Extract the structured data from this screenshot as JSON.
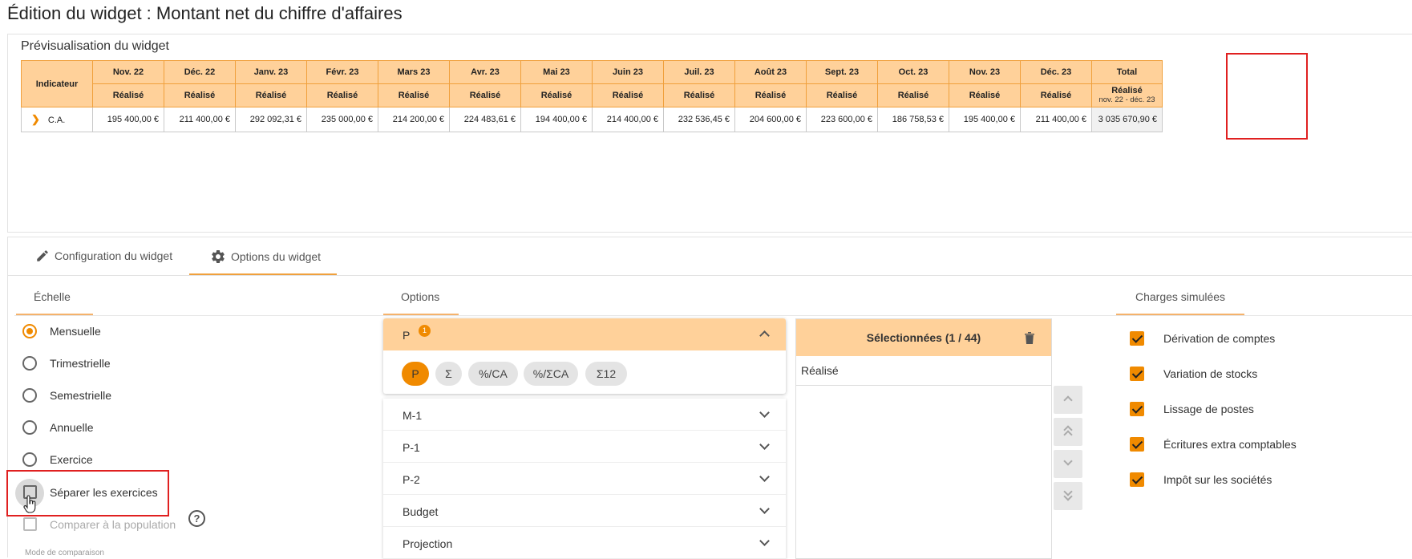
{
  "page": {
    "title": "Édition du widget : Montant net du chiffre d'affaires"
  },
  "preview": {
    "title": "Prévisualisation du widget",
    "indicator_header": "Indicateur",
    "months": [
      {
        "label": "Nov. 22",
        "sub": "Réalisé",
        "value": "195 400,00 €"
      },
      {
        "label": "Déc. 22",
        "sub": "Réalisé",
        "value": "211 400,00 €"
      },
      {
        "label": "Janv. 23",
        "sub": "Réalisé",
        "value": "292 092,31 €"
      },
      {
        "label": "Févr. 23",
        "sub": "Réalisé",
        "value": "235 000,00 €"
      },
      {
        "label": "Mars 23",
        "sub": "Réalisé",
        "value": "214 200,00 €"
      },
      {
        "label": "Avr. 23",
        "sub": "Réalisé",
        "value": "224 483,61 €"
      },
      {
        "label": "Mai 23",
        "sub": "Réalisé",
        "value": "194 400,00 €"
      },
      {
        "label": "Juin 23",
        "sub": "Réalisé",
        "value": "214 400,00 €"
      },
      {
        "label": "Juil. 23",
        "sub": "Réalisé",
        "value": "232 536,45 €"
      },
      {
        "label": "Août 23",
        "sub": "Réalisé",
        "value": "204 600,00 €"
      },
      {
        "label": "Sept. 23",
        "sub": "Réalisé",
        "value": "223 600,00 €"
      },
      {
        "label": "Oct. 23",
        "sub": "Réalisé",
        "value": "186 758,53 €"
      },
      {
        "label": "Nov. 23",
        "sub": "Réalisé",
        "value": "195 400,00 €"
      },
      {
        "label": "Déc. 23",
        "sub": "Réalisé",
        "value": "211 400,00 €"
      }
    ],
    "total": {
      "label": "Total",
      "sub": "Réalisé",
      "range": "nov. 22 - déc. 23",
      "value": "3 035 670,90 €"
    },
    "row_label": "C.A."
  },
  "tabs": {
    "config": "Configuration du widget",
    "options": "Options du widget"
  },
  "scale": {
    "title": "Échelle",
    "options": [
      "Mensuelle",
      "Trimestrielle",
      "Semestrielle",
      "Annuelle",
      "Exercice"
    ],
    "selected": "Mensuelle",
    "separate_label": "Séparer les exercices",
    "compare_label": "Comparer à la population",
    "comparison_mode": "Mode de comparaison"
  },
  "options": {
    "title": "Options",
    "active_item": {
      "label": "P",
      "badge": "1"
    },
    "pills": [
      "P",
      "Σ",
      "%/CA",
      "%/ΣCA",
      "Σ12"
    ],
    "active_pill": "P",
    "items": [
      "M-1",
      "P-1",
      "P-2",
      "Budget",
      "Projection"
    ]
  },
  "selected": {
    "title": "Sélectionnées (1 / 44)",
    "items": [
      "Réalisé"
    ]
  },
  "charges": {
    "title": "Charges simulées",
    "items": [
      "Dérivation de comptes",
      "Variation de stocks",
      "Lissage de postes",
      "Écritures extra comptables",
      "Impôt sur les sociétés"
    ]
  },
  "colors": {
    "accent": "#f08a00",
    "header_bg": "#ffd19a",
    "highlight_border": "#e02020"
  }
}
